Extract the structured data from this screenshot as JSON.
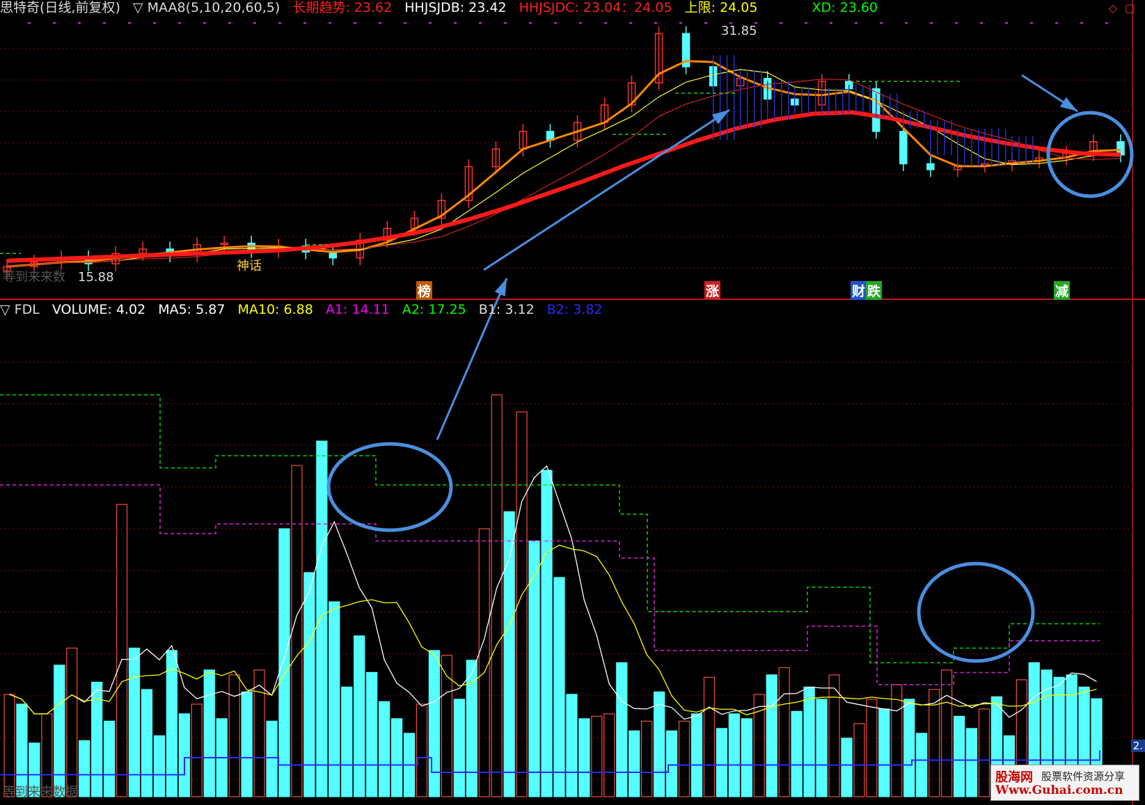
{
  "price_header": {
    "title": "思特奇(日线,前复权)",
    "indicator": "▽ MAA8(5,10,20,60,5)",
    "trend": "长期趋势: 23.62",
    "hhjsjdb": "HHJSJDB: 23.42",
    "hhjsjdc": "HHJSJDC: 23.04：24.05",
    "upper": "上限: 24.05",
    "xd": "XD: 23.60",
    "colors": {
      "title": "#dddddd",
      "trend": "#ff2020",
      "hhjsjdb": "#ffffff",
      "hhjsjdc": "#ff2020",
      "upper": "#ffff00",
      "xd": "#00ff00"
    }
  },
  "volume_header": {
    "name": "▽ FDL",
    "volume": "VOLUME: 4.02",
    "ma5": "MA5: 5.87",
    "ma10": "MA10: 6.88",
    "a1": "A1: 14.11",
    "a2": "A2: 17.25",
    "b1": "B1: 3.12",
    "b2": "B2: 3.82",
    "colors": {
      "name": "#dddddd",
      "volume": "#ffffff",
      "ma5": "#ffffff",
      "ma10": "#ffff00",
      "a1": "#ff00ff",
      "a2": "#00ff00",
      "b1": "#dddddd",
      "b2": "#2a2aff"
    }
  },
  "price_labels": {
    "high": "31.85",
    "low": "15.88",
    "shenhua": "神话",
    "left_hidden": "等到来来数"
  },
  "event_markers": [
    {
      "text": "榜",
      "color": "#ffffff",
      "bg": "#c05a00"
    },
    {
      "text": "涨",
      "color": "#ffffff",
      "bg": "#cc2222"
    },
    {
      "text": "财",
      "color": "#ffffff",
      "bg": "#2255cc"
    },
    {
      "text": "跌",
      "color": "#ffffff",
      "bg": "#22aa22"
    },
    {
      "text": "减",
      "color": "#ffffff",
      "bg": "#22aa22"
    }
  ],
  "volume_side_label": "2.",
  "bottom_hidden_text": "等到来来数据",
  "watermark": {
    "line1": "股海网",
    "line1b": "股票软件资源分享",
    "line2": "Www.Guhai.com.cn"
  },
  "chart_data": [
    {
      "type": "line",
      "title": "思特奇(日线,前复权)",
      "annotations": [
        "31.85",
        "15.88"
      ],
      "series": [
        {
          "name": "长期趋势",
          "color": "#ff1a1a",
          "values": [
            16.4,
            16.5,
            16.6,
            16.7,
            16.8,
            16.9,
            17.0,
            17.1,
            17.3,
            17.6,
            18.0,
            18.5,
            19.2,
            20.0,
            20.9,
            21.8,
            22.8,
            23.7,
            24.6,
            25.4,
            26.0,
            26.4,
            26.5,
            26.1,
            25.5,
            24.9,
            24.4,
            24.0,
            23.7,
            23.62
          ]
        }
      ],
      "candles_close": [
        16.0,
        16.3,
        16.6,
        16.2,
        16.9,
        17.2,
        16.8,
        17.5,
        17.6,
        17.1,
        17.4,
        17.0,
        16.6,
        17.8,
        18.6,
        19.3,
        20.5,
        22.8,
        24.0,
        25.2,
        24.6,
        25.8,
        27.0,
        28.5,
        31.85,
        29.6,
        28.3,
        28.8,
        27.4,
        27.0,
        28.6,
        28.1,
        25.2,
        23.0,
        22.6,
        22.9,
        23.0,
        23.2,
        23.4,
        23.7,
        24.5,
        23.6
      ]
    },
    {
      "type": "bar",
      "title": "FDL",
      "x_count": 88,
      "values": [
        4.2,
        3.8,
        2.2,
        3.4,
        5.4,
        6.1,
        2.3,
        4.7,
        3.1,
        12.0,
        6.1,
        4.4,
        2.5,
        6.0,
        3.4,
        3.8,
        5.2,
        3.2,
        5.0,
        4.3,
        5.2,
        3.1,
        11.0,
        13.6,
        9.2,
        14.6,
        8.0,
        4.5,
        6.6,
        5.1,
        3.9,
        3.2,
        2.6,
        3.8,
        6.0,
        5.8,
        4.0,
        5.6,
        11.0,
        16.5,
        11.7,
        15.8,
        10.5,
        13.4,
        9.0,
        4.2,
        3.2,
        3.3,
        3.4,
        5.5,
        2.7,
        3.1,
        4.3,
        2.7,
        3.1,
        3.4,
        4.9,
        2.8,
        3.4,
        3.2,
        4.2,
        5.0,
        5.3,
        3.5,
        4.5,
        4.0,
        5.0,
        2.4,
        3.0,
        4.0,
        3.6,
        4.6,
        4.0,
        2.6,
        4.4,
        5.2,
        3.3,
        2.8,
        3.6,
        4.1,
        2.5,
        4.8,
        5.5,
        5.2,
        4.9,
        5.0,
        4.5,
        4.02
      ],
      "series": [
        {
          "name": "VOLUME",
          "values": "bars"
        },
        {
          "name": "MA5",
          "color": "#ffffff"
        },
        {
          "name": "MA10",
          "color": "#ffff00"
        },
        {
          "name": "A1",
          "color": "#ff00ff"
        },
        {
          "name": "A2",
          "color": "#00ff00"
        },
        {
          "name": "B2",
          "color": "#2a2aff"
        }
      ]
    }
  ]
}
